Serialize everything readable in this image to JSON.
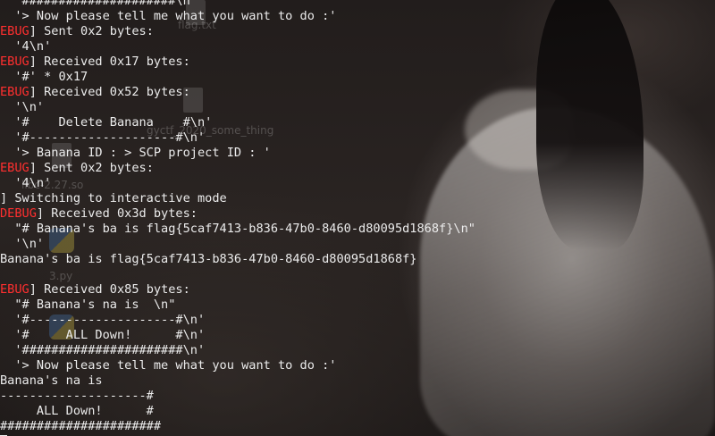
{
  "desktop": {
    "icons": [
      {
        "label": "flag.txt",
        "icon": "text-file-icon"
      },
      {
        "label": "gyctf_2020_some_thing",
        "icon": "binary-file-icon"
      },
      {
        "label": "libc-2.27.so",
        "icon": "library-file-icon"
      },
      {
        "label": "3.py",
        "icon": "python-file-icon"
      }
    ]
  },
  "terminal": {
    "lines": [
      {
        "tag": "",
        "text": "   #####################\\n'"
      },
      {
        "tag": "",
        "text": "  '> Now please tell me what you want to do :'"
      },
      {
        "tag": "EBUG",
        "text": "] Sent 0x2 bytes:"
      },
      {
        "tag": "",
        "text": "  '4\\n'"
      },
      {
        "tag": "EBUG",
        "text": "] Received 0x17 bytes:"
      },
      {
        "tag": "",
        "text": "  '#' * 0x17"
      },
      {
        "tag": "EBUG",
        "text": "] Received 0x52 bytes:"
      },
      {
        "tag": "",
        "text": "  '\\n'"
      },
      {
        "tag": "",
        "text": "  '#    Delete Banana    #\\n'"
      },
      {
        "tag": "",
        "text": "  '#--------------------#\\n'"
      },
      {
        "tag": "",
        "text": "  '> Banana ID : > SCP project ID : '"
      },
      {
        "tag": "EBUG",
        "text": "] Sent 0x2 bytes:"
      },
      {
        "tag": "",
        "text": "  '4\\n'"
      },
      {
        "tag": "",
        "text": "] Switching to interactive mode"
      },
      {
        "tag": "DEBUG",
        "text": "] Received 0x3d bytes:"
      },
      {
        "tag": "",
        "text": "  \"# Banana's ba is flag{5caf7413-b836-47b0-8460-d80095d1868f}\\n\""
      },
      {
        "tag": "",
        "text": "  '\\n'"
      },
      {
        "tag": "",
        "text": "Banana's ba is flag{5caf7413-b836-47b0-8460-d80095d1868f}"
      },
      {
        "tag": "",
        "text": ""
      },
      {
        "tag": "EBUG",
        "text": "] Received 0x85 bytes:"
      },
      {
        "tag": "",
        "text": "  \"# Banana's na is  \\n\""
      },
      {
        "tag": "",
        "text": "  '#--------------------#\\n'"
      },
      {
        "tag": "",
        "text": "  '#     ALL Down!      #\\n'"
      },
      {
        "tag": "",
        "text": "  '######################\\n'"
      },
      {
        "tag": "",
        "text": "  '> Now please tell me what you want to do :'"
      },
      {
        "tag": "",
        "text": "Banana's na is"
      },
      {
        "tag": "",
        "text": "--------------------#"
      },
      {
        "tag": "",
        "text": "     ALL Down!      #"
      },
      {
        "tag": "",
        "text": "######################"
      }
    ]
  },
  "colors": {
    "debug_tag": "#ff2f2f",
    "text": "#ececec"
  }
}
